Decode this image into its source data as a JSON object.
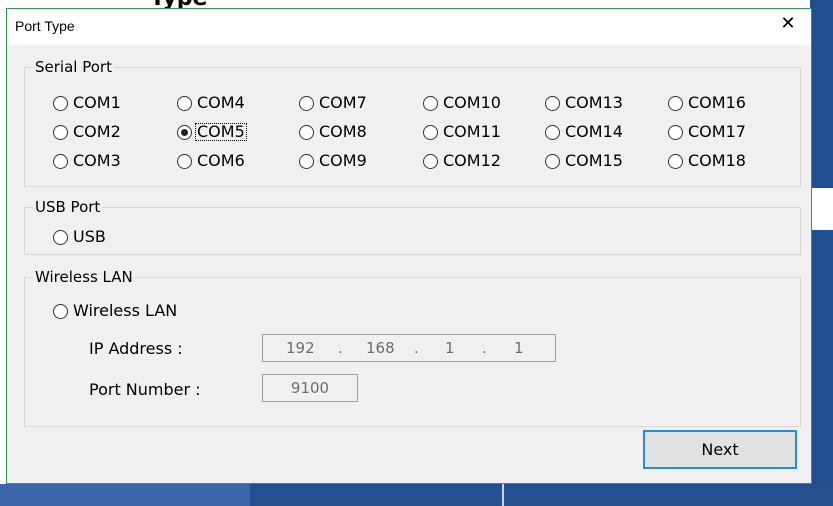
{
  "background": {
    "peek_text": "Type",
    "accent_color": "#1f4f8f"
  },
  "dialog": {
    "title": "Port Type",
    "close_glyph": "✕"
  },
  "serial_port": {
    "legend": "Serial Port",
    "options": [
      {
        "label": "COM1",
        "checked": false
      },
      {
        "label": "COM4",
        "checked": false
      },
      {
        "label": "COM7",
        "checked": false
      },
      {
        "label": "COM10",
        "checked": false
      },
      {
        "label": "COM13",
        "checked": false
      },
      {
        "label": "COM16",
        "checked": false
      },
      {
        "label": "COM2",
        "checked": false
      },
      {
        "label": "COM5",
        "checked": true
      },
      {
        "label": "COM8",
        "checked": false
      },
      {
        "label": "COM11",
        "checked": false
      },
      {
        "label": "COM14",
        "checked": false
      },
      {
        "label": "COM17",
        "checked": false
      },
      {
        "label": "COM3",
        "checked": false
      },
      {
        "label": "COM6",
        "checked": false
      },
      {
        "label": "COM9",
        "checked": false
      },
      {
        "label": "COM12",
        "checked": false
      },
      {
        "label": "COM15",
        "checked": false
      },
      {
        "label": "COM18",
        "checked": false
      }
    ]
  },
  "usb_port": {
    "legend": "USB Port",
    "option": {
      "label": "USB",
      "checked": false
    }
  },
  "wireless_lan": {
    "legend": "Wireless LAN",
    "option": {
      "label": "Wireless LAN",
      "checked": false
    },
    "ip_label": "IP Address :",
    "ip_octets": [
      "192",
      "168",
      "1",
      "1"
    ],
    "ip_separator": ".",
    "port_label": "Port Number :",
    "port_value": "9100"
  },
  "next_button": "Next",
  "focus_color": "#2a8ad6"
}
